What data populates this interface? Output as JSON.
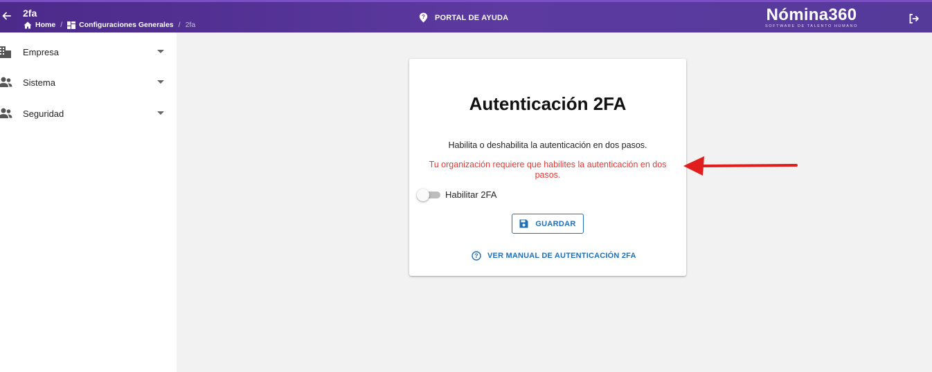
{
  "header": {
    "page_title": "2fa",
    "breadcrumb": {
      "home": "Home",
      "section": "Configuraciones Generales",
      "sep1": "/",
      "sep2": "/",
      "current": "2fa"
    },
    "help_portal": "PORTAL DE AYUDA",
    "brand_name": "Nómina360",
    "brand_tagline": "SOFTWARE DE TALENTO HUMANO",
    "icons": {
      "back": "arrow-left-icon",
      "home": "home-icon",
      "section": "dashboard-icon",
      "help": "help-location-icon",
      "logout": "logout-icon"
    }
  },
  "sidebar": {
    "items": [
      {
        "label": "Empresa",
        "icon": "building-icon"
      },
      {
        "label": "Sistema",
        "icon": "users-icon"
      },
      {
        "label": "Seguridad",
        "icon": "users-icon"
      }
    ]
  },
  "card": {
    "title": "Autenticación 2FA",
    "description": "Habilita o deshabilita la autenticación en dos pasos.",
    "warning": "Tu organización requiere que habilites la autenticación en dos pasos.",
    "toggle_label": "Habilitar 2FA",
    "toggle_enabled": false,
    "save_label": "GUARDAR",
    "manual_link": "VER MANUAL DE AUTENTICACIÓN 2FA"
  },
  "colors": {
    "header_primary": "#5c3aa0",
    "accent_blue": "#1e6fb8",
    "warning_red": "#e53935",
    "annotation_arrow": "#e01e1e"
  }
}
